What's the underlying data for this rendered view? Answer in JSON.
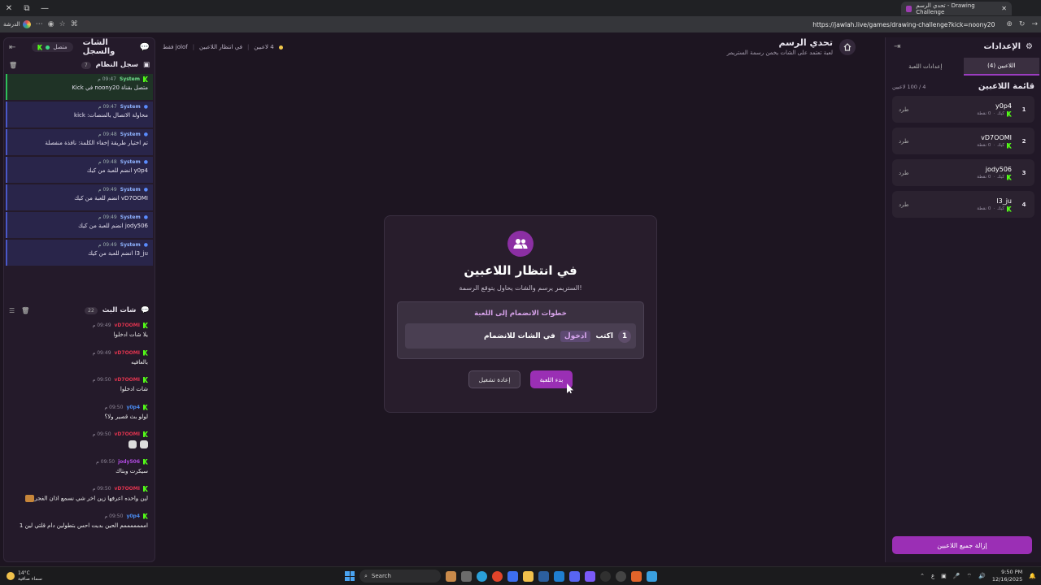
{
  "browser": {
    "tab_title": "تحدي الرسم - Drawing Challenge",
    "url": "https://jawlah.live/games/drawing-challenge?kick=noony20",
    "store_label": "الدرشة"
  },
  "left_panel": {
    "title": "الشات والسجل",
    "connected_label": "متصل",
    "system_log": {
      "title": "سجل النظام",
      "count": "7",
      "items": [
        {
          "who": "System",
          "time": "09:47 م",
          "text": "متصل بقناة noony20 في Kick"
        },
        {
          "who": "System",
          "time": "09:47 م",
          "text": "محاولة الاتصال بالمنصات: kick"
        },
        {
          "who": "System",
          "time": "09:48 م",
          "text": "تم اختيار طريقة إخفاء الكلمة: نافذة منفصلة"
        },
        {
          "who": "System",
          "time": "09:48 م",
          "text": "y0p4 انضم للعبة من كيك"
        },
        {
          "who": "System",
          "time": "09:49 م",
          "text": "vD7OOMI انضم للعبة من كيك"
        },
        {
          "who": "System",
          "time": "09:49 م",
          "text": "jody506 انضم للعبة من كيك"
        },
        {
          "who": "System",
          "time": "09:49 م",
          "text": "l3_ju انضم للعبة من كيك"
        }
      ]
    },
    "live_chat": {
      "title": "شات البث",
      "count": "22",
      "items": [
        {
          "name": "vD7OOMI",
          "time": "09:49 م",
          "text": "يلا شات ادخلوا",
          "color": "#e0344f"
        },
        {
          "name": "vD7OOMI",
          "time": "09:49 م",
          "text": "بالعافيه",
          "color": "#e0344f"
        },
        {
          "name": "vD7OOMI",
          "time": "09:50 م",
          "text": "شات ادخلوا",
          "color": "#e0344f"
        },
        {
          "name": "y0p4",
          "time": "09:50 م",
          "text": "لولو بث قصير ولا؟",
          "color": "#4a8bf0"
        },
        {
          "name": "vD7OOMI",
          "time": "09:50 م",
          "text": "",
          "color": "#e0344f"
        },
        {
          "name": "jody506",
          "time": "09:50 م",
          "text": "سيكرت وبتاك",
          "color": "#b04ae0"
        },
        {
          "name": "vD7OOMI",
          "time": "09:50 م",
          "text": "لين واحده اعرفها زين اخر شي نسمع اذان الفجر",
          "color": "#e0344f"
        },
        {
          "name": "y0p4",
          "time": "09:50 م",
          "text": "امممممممم الحين بديت احس بتطولين دام قلتي لين 1",
          "color": "#4a8bf0"
        }
      ]
    }
  },
  "header": {
    "players_count": "4 لاعبين",
    "state": "في انتظار اللاعبين",
    "mode": "jolof فقط",
    "title": "تحدي الرسم",
    "subtitle": "لعبة تعتمد على الشات يخمن رسمة الستريمر"
  },
  "right_panel": {
    "title": "الإعدادات",
    "tabs": [
      {
        "label": "اللاعبين (4)",
        "active": true
      },
      {
        "label": "إعدادات اللعبة",
        "active": false
      }
    ],
    "list_title": "قائمة اللاعبين",
    "list_count": "4 / 100 لاعبين",
    "platform": "كيك",
    "kick_label": "طرد",
    "players": [
      {
        "rank": "1",
        "name": "y0p4",
        "points": "0 نقطة"
      },
      {
        "rank": "2",
        "name": "vD7OOMI",
        "points": "0 نقطة"
      },
      {
        "rank": "3",
        "name": "jody506",
        "points": "0 نقطة"
      },
      {
        "rank": "4",
        "name": "l3_ju",
        "points": "0 نقطة"
      }
    ],
    "remove_all": "إزالة جميع اللاعبين"
  },
  "modal": {
    "title": "في انتظار اللاعبين",
    "subtitle": "الستريمر يرسم والشات يحاول يتوقع الرسمة!",
    "steps_title": "خطوات الانضمام إلى اللعبة",
    "step_number": "1",
    "step_prefix": "اكتب",
    "step_keyword": "ادخول",
    "step_suffix": "في الشات للانضمام",
    "start_button": "بدء اللعبة",
    "reset_button": "إعادة تشغيل"
  },
  "taskbar": {
    "temp": "14°C",
    "weather": "سماء صافية",
    "search": "Search",
    "lang": "ع",
    "time": "9:50 PM",
    "date": "12/16/2025"
  }
}
